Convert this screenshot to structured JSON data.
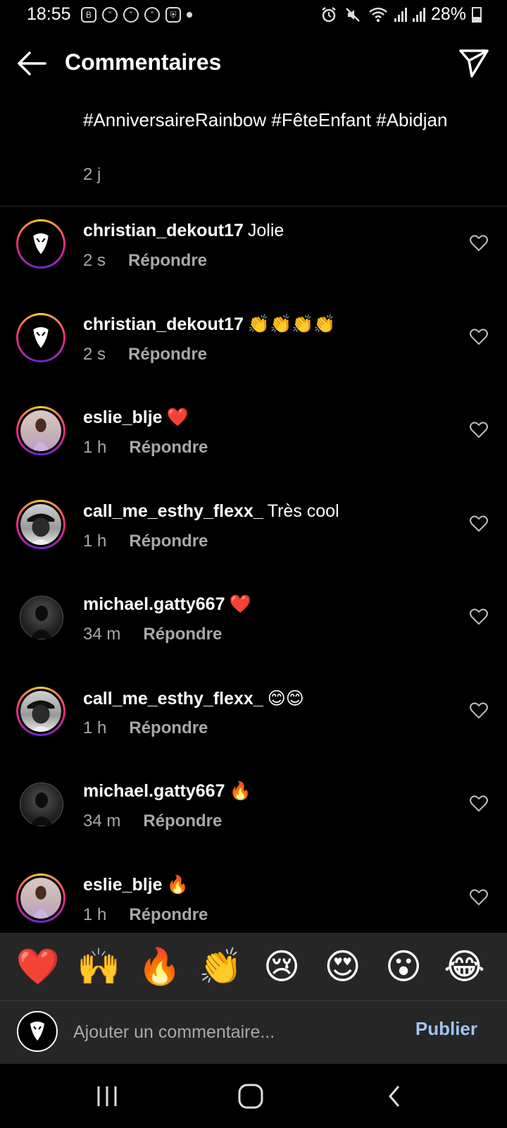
{
  "status_bar": {
    "time": "18:55",
    "battery": "28%",
    "left_icons": [
      "b-app-icon",
      "quote-icon",
      "quote-icon",
      "quote-icon",
      "shield-icon"
    ],
    "right_icons": [
      "alarm-icon",
      "mute-icon",
      "wifi-icon",
      "signal-icon",
      "signal-icon",
      "battery-icon"
    ]
  },
  "header": {
    "title": "Commentaires"
  },
  "post": {
    "caption": "#AnniversaireRainbow #FêteEnfant #Abidjan",
    "time": "2 j"
  },
  "comments": [
    {
      "username": "christian_dekout17",
      "text": "Jolie",
      "time": "2 s",
      "reply": "Répondre",
      "avatar": "mask"
    },
    {
      "username": "christian_dekout17",
      "text": "👏👏👏👏",
      "time": "2 s",
      "reply": "Répondre",
      "avatar": "mask"
    },
    {
      "username": "eslie_blje",
      "text": "❤️",
      "time": "1 h",
      "reply": "Répondre",
      "avatar": "girl"
    },
    {
      "username": "call_me_esthy_flexx_",
      "text": "Très cool",
      "time": "1 h",
      "reply": "Répondre",
      "avatar": "boy"
    },
    {
      "username": "michael.gatty667",
      "text": "❤️",
      "time": "34 m",
      "reply": "Répondre",
      "avatar": "dark"
    },
    {
      "username": "call_me_esthy_flexx_",
      "text": "😊😊",
      "time": "1 h",
      "reply": "Répondre",
      "avatar": "boy"
    },
    {
      "username": "michael.gatty667",
      "text": "🔥",
      "time": "34 m",
      "reply": "Répondre",
      "avatar": "dark"
    },
    {
      "username": "eslie_blje",
      "text": "🔥",
      "time": "1 h",
      "reply": "Répondre",
      "avatar": "girl"
    }
  ],
  "emoji_bar": [
    "❤️",
    "🙌",
    "🔥",
    "👏",
    "😢",
    "😍",
    "😮",
    "😂"
  ],
  "compose": {
    "placeholder": "Ajouter un commentaire...",
    "publish_label": "Publier"
  },
  "nav": {
    "icons": [
      "recents-icon",
      "home-icon",
      "back-icon"
    ]
  },
  "colors": {
    "background": "#000000",
    "secondary_text": "#a8a8a8",
    "input_bar": "#262626",
    "publish": "#9fc5ef"
  }
}
